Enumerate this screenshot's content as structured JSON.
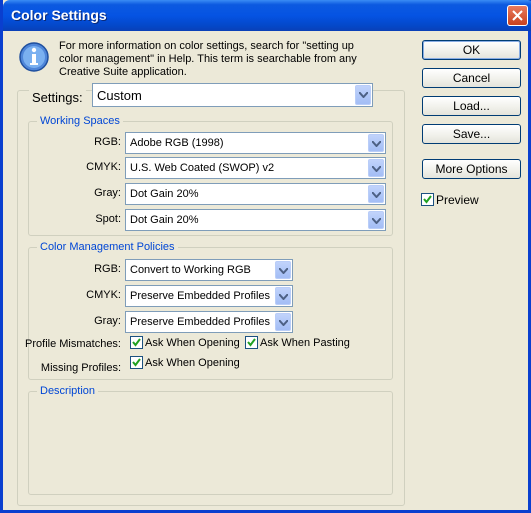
{
  "window": {
    "title": "Color Settings"
  },
  "info": {
    "text": "For more information on color settings, search for \"setting up color management\" in Help. This term is searchable from any Creative Suite application."
  },
  "settings": {
    "label": "Settings:",
    "value": "Custom"
  },
  "working_spaces": {
    "title": "Working Spaces",
    "rgb": {
      "label": "RGB:",
      "value": "Adobe RGB (1998)"
    },
    "cmyk": {
      "label": "CMYK:",
      "value": "U.S. Web Coated (SWOP) v2"
    },
    "gray": {
      "label": "Gray:",
      "value": "Dot Gain 20%"
    },
    "spot": {
      "label": "Spot:",
      "value": "Dot Gain 20%"
    }
  },
  "policies": {
    "title": "Color Management Policies",
    "rgb": {
      "label": "RGB:",
      "value": "Convert to Working RGB"
    },
    "cmyk": {
      "label": "CMYK:",
      "value": "Preserve Embedded Profiles"
    },
    "gray": {
      "label": "Gray:",
      "value": "Preserve Embedded Profiles"
    },
    "profile_mismatches": {
      "label": "Profile Mismatches:",
      "ask_opening": {
        "label": "Ask When Opening",
        "checked": true
      },
      "ask_pasting": {
        "label": "Ask When Pasting",
        "checked": true
      }
    },
    "missing_profiles": {
      "label": "Missing Profiles:",
      "ask_opening": {
        "label": "Ask When Opening",
        "checked": true
      }
    }
  },
  "description": {
    "title": "Description"
  },
  "buttons": {
    "ok": "OK",
    "cancel": "Cancel",
    "load": "Load...",
    "save": "Save...",
    "more_options": "More Options"
  },
  "preview": {
    "label": "Preview",
    "checked": true
  },
  "colors": {
    "titlebar": "#0553e3",
    "group_title": "#0046d5",
    "dialog_bg": "#ece9d8"
  }
}
